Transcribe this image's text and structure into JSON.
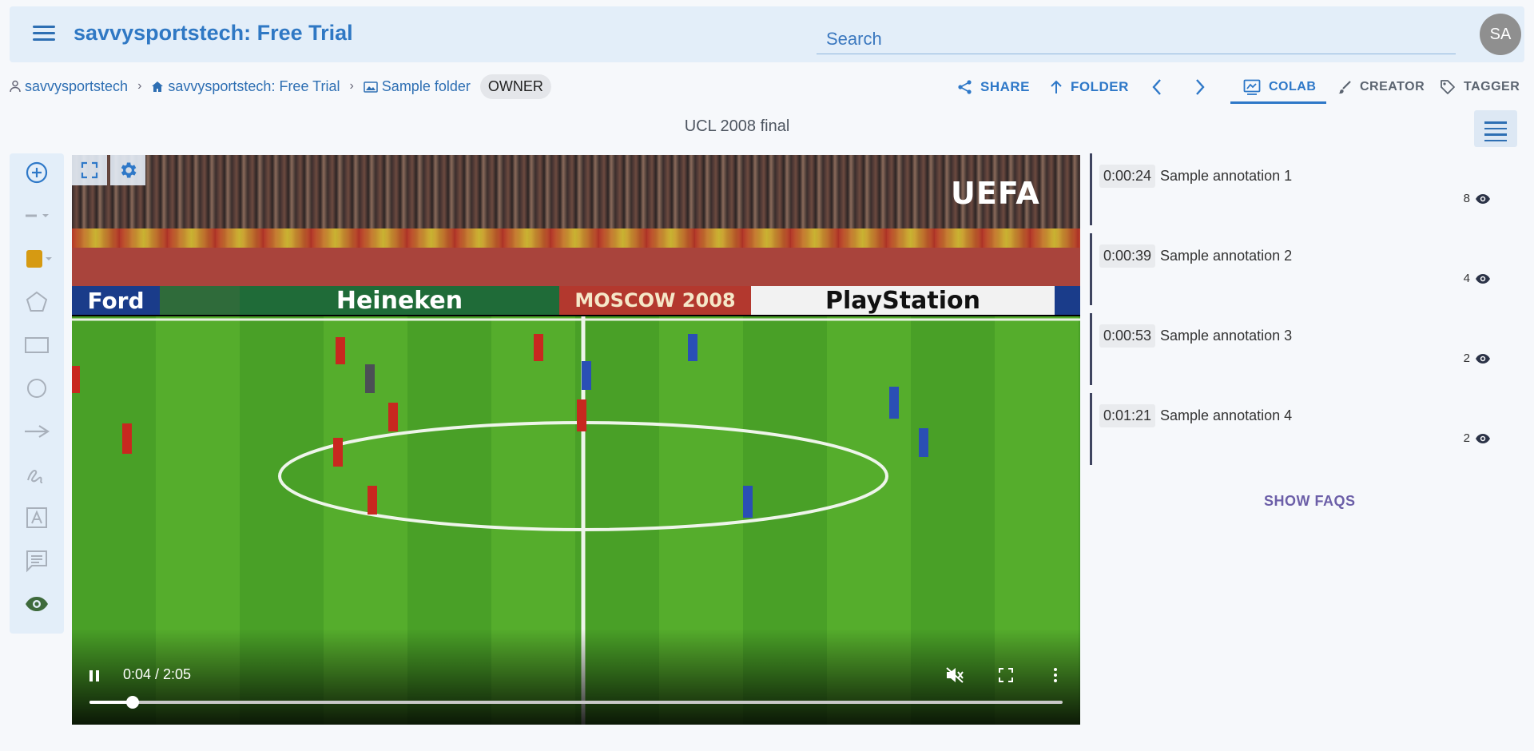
{
  "header": {
    "app_title": "savvysportstech: Free Trial",
    "search_placeholder": "Search",
    "avatar_initials": "SA"
  },
  "breadcrumb": {
    "items": [
      {
        "label": "savvysportstech",
        "icon": "person-icon"
      },
      {
        "label": "savvysportstech: Free Trial",
        "icon": "home-icon"
      },
      {
        "label": "Sample folder",
        "icon": "image-folder-icon"
      }
    ],
    "badge": "OWNER"
  },
  "toolbar": {
    "share_label": "SHARE",
    "folder_label": "FOLDER",
    "modes": [
      {
        "label": "COLAB",
        "icon": "colab-icon",
        "active": true
      },
      {
        "label": "CREATOR",
        "icon": "brush-icon",
        "active": false
      },
      {
        "label": "TAGGER",
        "icon": "tag-icon",
        "active": false
      }
    ]
  },
  "video": {
    "title": "UCL 2008 final",
    "current_time": "0:04",
    "duration": "2:05",
    "time_display": "0:04 / 2:05",
    "progress": 0.0443,
    "overlay_logo": "UEFA",
    "ad_boards": [
      "Ford",
      "Heineken",
      "MOSCOW 2008",
      "PlayStation"
    ]
  },
  "palette": {
    "tools": [
      "add-circle-icon",
      "line-style-icon",
      "color-swatch-icon",
      "pentagon-icon",
      "rectangle-icon",
      "circle-icon",
      "arrow-icon",
      "freehand-icon",
      "text-box-icon",
      "comment-icon",
      "eye-icon"
    ],
    "swatch_color": "#d69a12"
  },
  "annotations": [
    {
      "timestamp": "0:00:24",
      "label": "Sample annotation 1",
      "views": "8"
    },
    {
      "timestamp": "0:00:39",
      "label": "Sample annotation 2",
      "views": "4"
    },
    {
      "timestamp": "0:00:53",
      "label": "Sample annotation 3",
      "views": "2"
    },
    {
      "timestamp": "0:01:21",
      "label": "Sample annotation 4",
      "views": "2"
    }
  ],
  "faqs_label": "SHOW FAQS",
  "colors": {
    "accent": "#2e78c8",
    "appbar_bg": "#e3eef9",
    "faq": "#6c5fa8",
    "annotation_bar": "#3f4560"
  }
}
